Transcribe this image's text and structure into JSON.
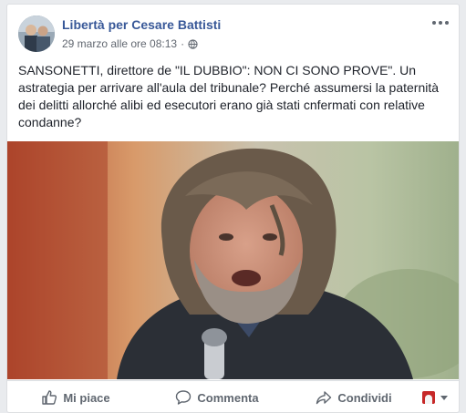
{
  "post": {
    "page_name": "Libertà per Cesare Battisti",
    "timestamp": "29 marzo alle ore 08:13",
    "separator": "·",
    "privacy_icon": "globe-icon",
    "menu_icon": "more-options-icon",
    "text": "SANSONETTI, direttore de \"IL DUBBIO\": NON CI SONO PROVE\". Un astrategia per arrivare all'aula del tribunale? Perché assumersi la paternità dei delitti allorché alibi ed esecutori erano già stati cnfermati con relative condanne?"
  },
  "actions": {
    "like_label": "Mi piace",
    "comment_label": "Commenta",
    "share_label": "Condividi"
  },
  "colors": {
    "page_name": "#385898",
    "meta_text": "#616770",
    "body_text": "#1d2129",
    "action_text": "#606770",
    "background": "#e9ebee"
  }
}
